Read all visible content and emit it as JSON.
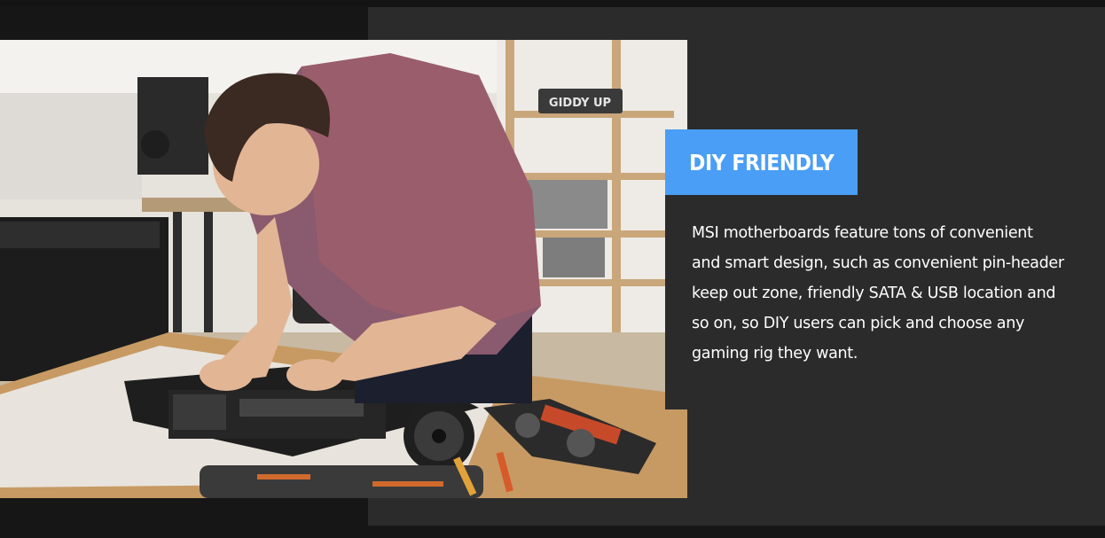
{
  "feature": {
    "title": "DIY FRIENDLY",
    "description": "MSI motherboards feature tons of convenient and smart design, such as convenient pin-header keep out zone, friendly SATA & USB location and so on, so DIY users can pick and choose any gaming rig they want.",
    "image": {
      "subject": "man-assembling-motherboard",
      "shelf_sign": "GIDDY UP"
    }
  },
  "colors": {
    "background": "#161616",
    "panel": "#2b2b2b",
    "accent": "#4a9ef5",
    "text": "#ffffff"
  }
}
